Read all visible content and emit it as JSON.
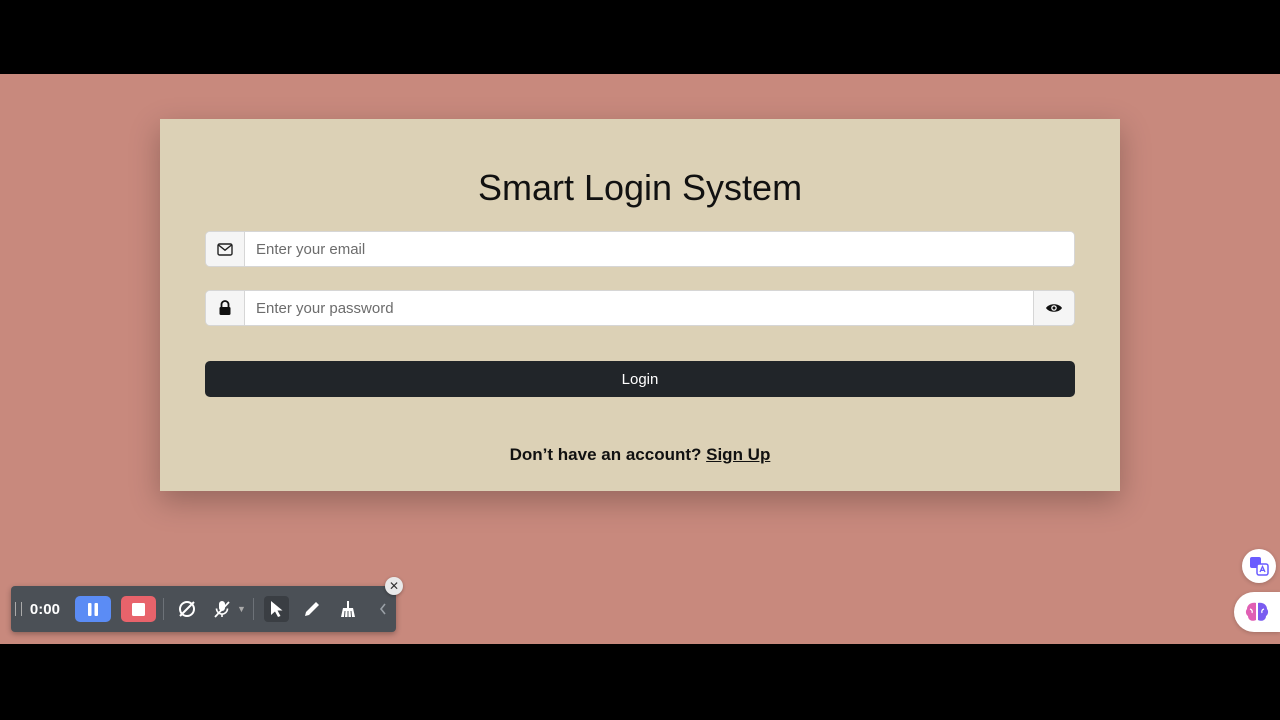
{
  "app": {
    "title": "Smart Login System"
  },
  "form": {
    "email": {
      "value": "",
      "placeholder": "Enter your email",
      "icon": "envelope-icon"
    },
    "password": {
      "value": "",
      "placeholder": "Enter your password",
      "icon": "lock-icon",
      "toggle_icon": "eye-icon"
    },
    "login_label": "Login",
    "signup_prompt": "Don’t have an account?",
    "signup_link": "Sign Up"
  },
  "recorder": {
    "time": "0:00",
    "icons": [
      "pause-icon",
      "stop-icon",
      "camera-off-icon",
      "mic-off-icon",
      "cursor-icon",
      "pen-icon",
      "broom-icon",
      "chevron-left-icon"
    ],
    "close_glyph": "✕"
  },
  "colors": {
    "page_background": "#c8897d",
    "card_background": "#dcd1b6",
    "login_button": "#212529",
    "pause_button": "#5b8cf5",
    "stop_button": "#e8636b"
  }
}
